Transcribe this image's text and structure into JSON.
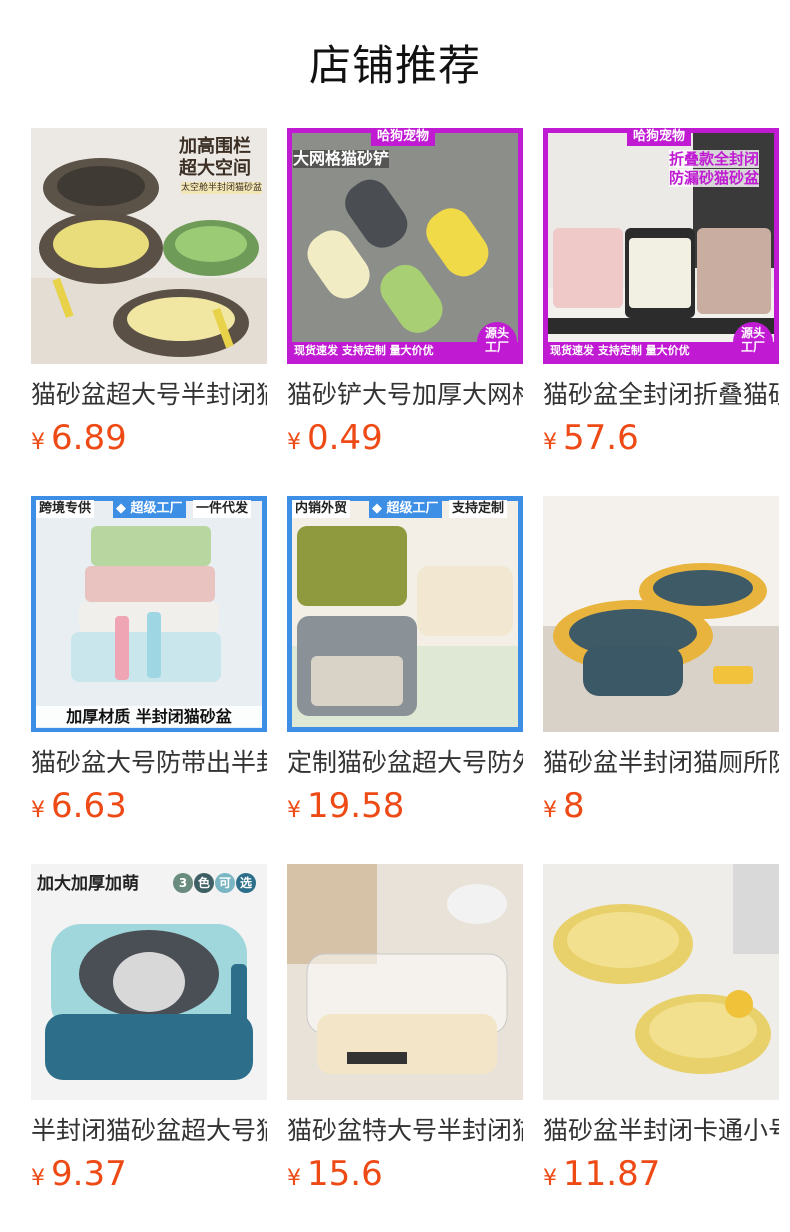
{
  "page": {
    "title": "店铺推荐",
    "currency_symbol": "¥"
  },
  "products": [
    {
      "name": "猫砂盆超大号半封闭猫",
      "price": "6.89",
      "image_text": [
        "加高围栏",
        "超大空间",
        "太空舱半封闭猫砂盆"
      ]
    },
    {
      "name": "猫砂铲大号加厚大网格",
      "price": "0.49",
      "image_text": [
        "哈狗宠物",
        "大网格猫砂铲",
        "现货速发 支持定制 量大价优",
        "源头",
        "工厂"
      ]
    },
    {
      "name": "猫砂盆全封闭折叠猫砂",
      "price": "57.6",
      "image_text": [
        "哈狗宠物",
        "折叠款全封闭",
        "防漏砂猫砂盆",
        "现货速发 支持定制 量大价优",
        "源头",
        "工厂"
      ]
    },
    {
      "name": "猫砂盆大号防带出半封",
      "price": "6.63",
      "image_text": [
        "跨境专供",
        "超级工厂",
        "一件代发",
        "加厚材质 半封闭猫砂盆"
      ]
    },
    {
      "name": "定制猫砂盆超大号防外",
      "price": "19.58",
      "image_text": [
        "内销外贸",
        "超级工厂",
        "支持定制"
      ]
    },
    {
      "name": "猫砂盆半封闭猫厕所防",
      "price": "8",
      "image_text": []
    },
    {
      "name": "半封闭猫砂盆超大号猫",
      "price": "9.37",
      "image_text": [
        "加大加厚加萌",
        "3",
        "色",
        "可",
        "选"
      ]
    },
    {
      "name": "猫砂盆特大号半封闭猫",
      "price": "15.6",
      "image_text": []
    },
    {
      "name": "猫砂盆半封闭卡通小号",
      "price": "11.87",
      "image_text": []
    }
  ],
  "colors": {
    "price": "#ee4a16",
    "frame_magenta": "#c01ad3",
    "frame_blue": "#3d8fe6"
  },
  "icons": [
    "diamond-icon"
  ]
}
